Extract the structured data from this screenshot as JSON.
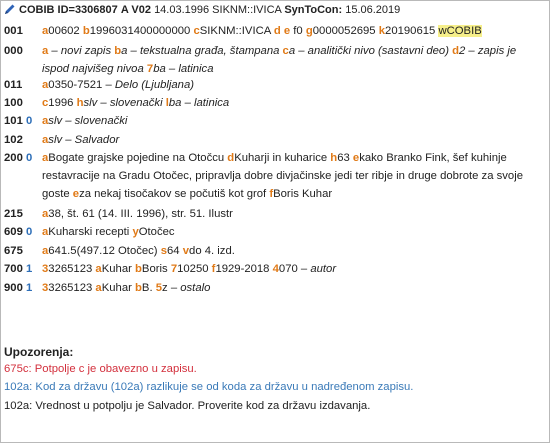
{
  "header": {
    "code": "COBIB",
    "id": "ID=3306807",
    "type": "A V02",
    "date_user": "14.03.1996 SIKNM::IVICA",
    "synto_label": "SynToCon:",
    "synto_date": "15.06.2019"
  },
  "records": [
    {
      "tag": "001",
      "ind": "",
      "content": [
        {
          "t": "a",
          "s": 1
        },
        {
          "t": "00602 "
        },
        {
          "t": "b",
          "s": 1
        },
        {
          "t": "1996031400000000 "
        },
        {
          "t": "c",
          "s": 1
        },
        {
          "t": "SIKNM::IVICA "
        },
        {
          "t": "d",
          "s": 1
        },
        {
          "t": " "
        },
        {
          "t": "e",
          "s": 1
        },
        {
          "t": " f0 "
        },
        {
          "t": "g",
          "s": 1
        },
        {
          "t": "0000052695 "
        },
        {
          "t": "k",
          "s": 1
        },
        {
          "t": "20190615 "
        },
        {
          "t": "wCOBIB",
          "h": 1
        }
      ]
    },
    {
      "tag": "000",
      "ind": "",
      "content": [
        {
          "t": "a",
          "s": 1
        },
        {
          "t": " – novi zapis ",
          "i": 1
        },
        {
          "t": "b",
          "s": 1
        },
        {
          "t": "a – tekstualna građa, štampana ",
          "i": 1
        },
        {
          "t": "c",
          "s": 1
        },
        {
          "t": "a – analitički nivo (sastavni deo) ",
          "i": 1
        },
        {
          "t": "d",
          "s": 1
        },
        {
          "t": "2 – zapis je ispod najvišeg nivoa ",
          "i": 1
        },
        {
          "t": "7",
          "s": 1
        },
        {
          "t": "ba – latinica",
          "i": 1
        }
      ]
    },
    {
      "tag": "011",
      "ind": "",
      "content": [
        {
          "t": "a",
          "s": 1
        },
        {
          "t": "0350-7521 – "
        },
        {
          "t": "Delo (Ljubljana)",
          "i": 1
        }
      ]
    },
    {
      "tag": "100",
      "ind": "",
      "content": [
        {
          "t": "c",
          "s": 1
        },
        {
          "t": "1996 "
        },
        {
          "t": "h",
          "s": 1
        },
        {
          "t": "slv – slovenački ",
          "i": 1
        },
        {
          "t": "l",
          "s": 1
        },
        {
          "t": "ba – latinica",
          "i": 1
        }
      ]
    },
    {
      "tag": "101",
      "ind": "0",
      "content": [
        {
          "t": "a",
          "s": 1
        },
        {
          "t": "slv – slovenački",
          "i": 1
        }
      ]
    },
    {
      "tag": "102",
      "ind": "",
      "content": [
        {
          "t": "a",
          "s": 1
        },
        {
          "t": "slv – Salvador",
          "i": 1
        }
      ]
    },
    {
      "tag": "200",
      "ind": "0",
      "content": [
        {
          "t": "a",
          "s": 1
        },
        {
          "t": "Bogate grajske pojedine na Otočcu "
        },
        {
          "t": "d",
          "s": 1
        },
        {
          "t": "Kuharji in kuharice "
        },
        {
          "t": "h",
          "s": 1
        },
        {
          "t": "63 "
        },
        {
          "t": "e",
          "s": 1
        },
        {
          "t": "kako Branko Fink, šef kuhinje restavracije na Gradu Otočec, pripravlja dobre divjačinske jedi ter ribje in druge dobrote za svoje goste "
        },
        {
          "t": "e",
          "s": 1
        },
        {
          "t": "za nekaj tisočakov se počutiš kot grof "
        },
        {
          "t": "f",
          "s": 1
        },
        {
          "t": "Boris Kuhar"
        }
      ]
    },
    {
      "tag": "215",
      "ind": "",
      "content": [
        {
          "t": "a",
          "s": 1
        },
        {
          "t": "38, št. 61 (14. III. 1996), str. 51. Ilustr"
        }
      ]
    },
    {
      "tag": "609",
      "ind": "0",
      "content": [
        {
          "t": "a",
          "s": 1
        },
        {
          "t": "Kuharski recepti "
        },
        {
          "t": "y",
          "s": 1
        },
        {
          "t": "Otočec"
        }
      ]
    },
    {
      "tag": "675",
      "ind": "",
      "content": [
        {
          "t": "a",
          "s": 1
        },
        {
          "t": "641.5(497.12 Otočec) "
        },
        {
          "t": "s",
          "s": 1
        },
        {
          "t": "64 "
        },
        {
          "t": "v",
          "s": 1
        },
        {
          "t": "do 4. izd."
        }
      ]
    },
    {
      "tag": "700",
      "ind": "1",
      "content": [
        {
          "t": "3",
          "s": 1
        },
        {
          "t": "3265123 "
        },
        {
          "t": "a",
          "s": 1
        },
        {
          "t": "Kuhar "
        },
        {
          "t": "b",
          "s": 1
        },
        {
          "t": "Boris "
        },
        {
          "t": "7",
          "s": 1
        },
        {
          "t": "10250 "
        },
        {
          "t": "f",
          "s": 1
        },
        {
          "t": "1929-2018 "
        },
        {
          "t": "4",
          "s": 1
        },
        {
          "t": "070 – "
        },
        {
          "t": "autor",
          "i": 1
        }
      ]
    },
    {
      "tag": "900",
      "ind": "1",
      "content": [
        {
          "t": "3",
          "s": 1
        },
        {
          "t": "3265123 "
        },
        {
          "t": "a",
          "s": 1
        },
        {
          "t": "Kuhar "
        },
        {
          "t": "b",
          "s": 1
        },
        {
          "t": "B. "
        },
        {
          "t": "5",
          "s": 1
        },
        {
          "t": "z – "
        },
        {
          "t": "ostalo",
          "i": 1
        }
      ]
    }
  ],
  "warnings": {
    "title": "Upozorenja:",
    "items": [
      {
        "text": "675c: Potpolje c je obavezno u zapisu.",
        "color": "#d3303d"
      },
      {
        "text": "102a: Kod za državu (102a) razlikuje se od koda za državu u nadređenom zapisu.",
        "color": "#3a7ab8"
      },
      {
        "text": "102a: Vrednost u potpolju je Salvador. Proverite kod za državu izdavanja.",
        "color": "#222222"
      }
    ]
  }
}
